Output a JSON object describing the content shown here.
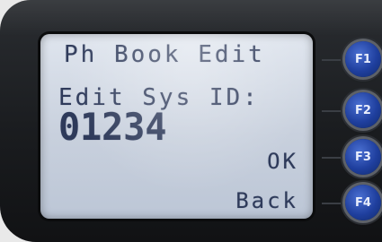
{
  "screen": {
    "title": "Ph Book Edit",
    "field_label": "Edit Sys ID:",
    "field_value": "01234",
    "soft_labels": {
      "ok": "OK",
      "back": "Back"
    }
  },
  "function_keys": [
    {
      "label": "F1"
    },
    {
      "label": "F2"
    },
    {
      "label": "F3"
    },
    {
      "label": "F4"
    }
  ],
  "colors": {
    "lcd_text": "#2e3a5a",
    "lcd_background": "#c8d0dd",
    "key_blue": "#1f3f9e",
    "bezel": "#1a1c1f"
  }
}
